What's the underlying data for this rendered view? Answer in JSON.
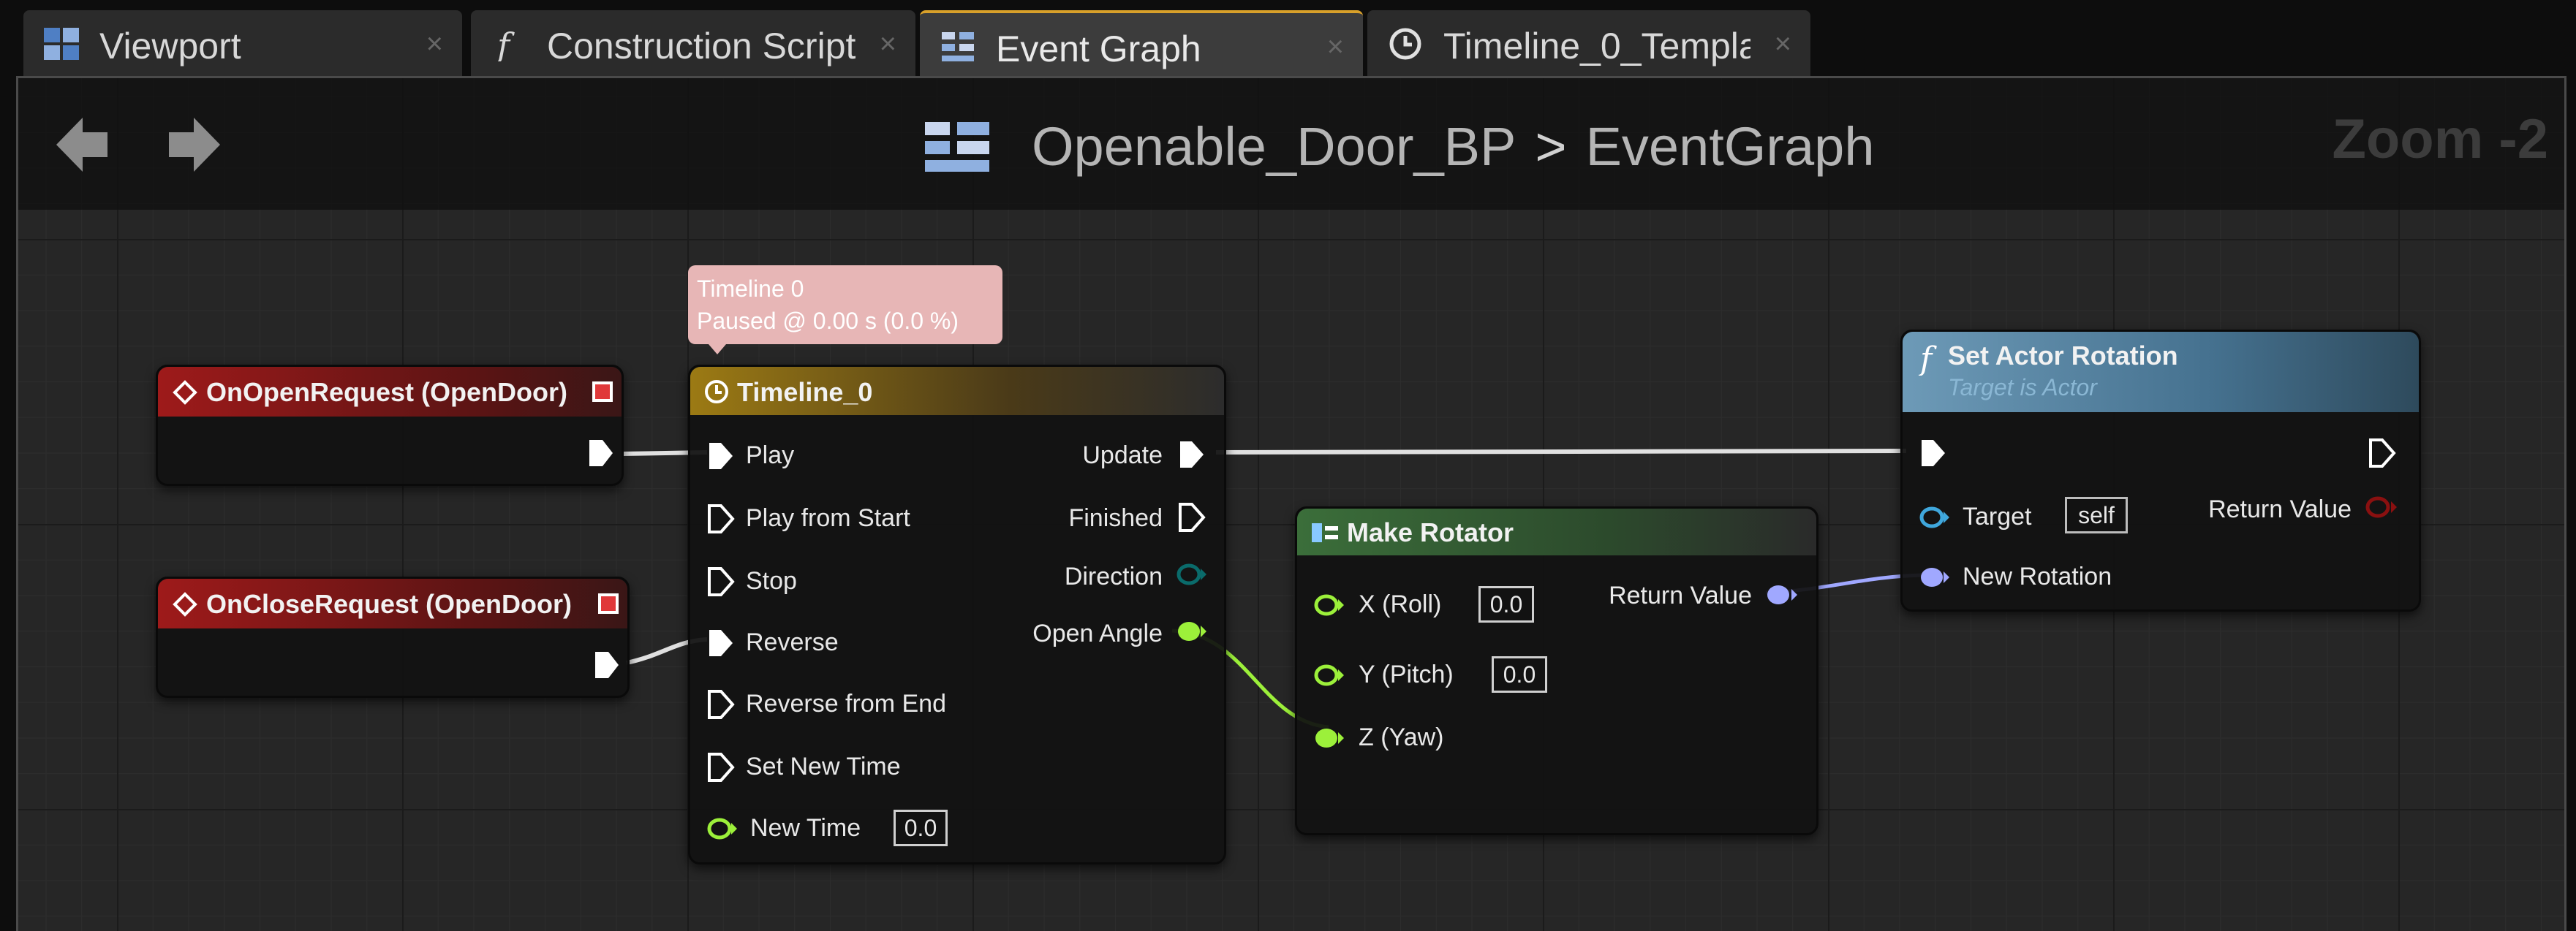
{
  "tabs": [
    {
      "label": "Viewport",
      "icon": "viewport-icon",
      "active": false
    },
    {
      "label": "Construction Script",
      "icon": "function-icon",
      "active": false
    },
    {
      "label": "Event Graph",
      "icon": "event-graph-icon",
      "active": true
    },
    {
      "label": "Timeline_0_Templa",
      "icon": "timeline-clock-icon",
      "active": false
    }
  ],
  "tab_close_glyph": "×",
  "header": {
    "blueprint_name": "Openable_Door_BP",
    "separator": ">",
    "graph_name": "EventGraph",
    "zoom": "Zoom -2"
  },
  "nodes": {
    "on_open": {
      "title": "OnOpenRequest (OpenDoor)"
    },
    "on_close": {
      "title": "OnCloseRequest (OpenDoor)"
    },
    "timeline": {
      "title": "Timeline_0",
      "bubble_line1": "Timeline 0",
      "bubble_line2": "Paused @ 0.00 s (0.0 %)",
      "inputs": [
        "Play",
        "Play from Start",
        "Stop",
        "Reverse",
        "Reverse from End",
        "Set New Time",
        "New Time"
      ],
      "new_time_value": "0.0",
      "outputs": [
        "Update",
        "Finished",
        "Direction",
        "Open Angle"
      ]
    },
    "make_rotator": {
      "title": "Make Rotator",
      "inputs": [
        "X (Roll)",
        "Y (Pitch)",
        "Z (Yaw)"
      ],
      "x_value": "0.0",
      "y_value": "0.0",
      "output": "Return Value"
    },
    "set_actor_rotation": {
      "title": "Set Actor Rotation",
      "subtitle": "Target is Actor",
      "target_label": "Target",
      "target_value": "self",
      "new_rotation_label": "New Rotation",
      "return_label": "Return Value"
    }
  },
  "colors": {
    "exec": "#ffffff",
    "float_pin": "#9cf03a",
    "rotator_pin": "#a0a8ff",
    "object_pin": "#3fa7dc",
    "direction_pin": "#0a6b6b",
    "bool_return_pin": "#8a1010",
    "event_header": "#9e1a1a",
    "timeline_header": "#9c7a14",
    "accent_tab": "#d8a02a"
  }
}
